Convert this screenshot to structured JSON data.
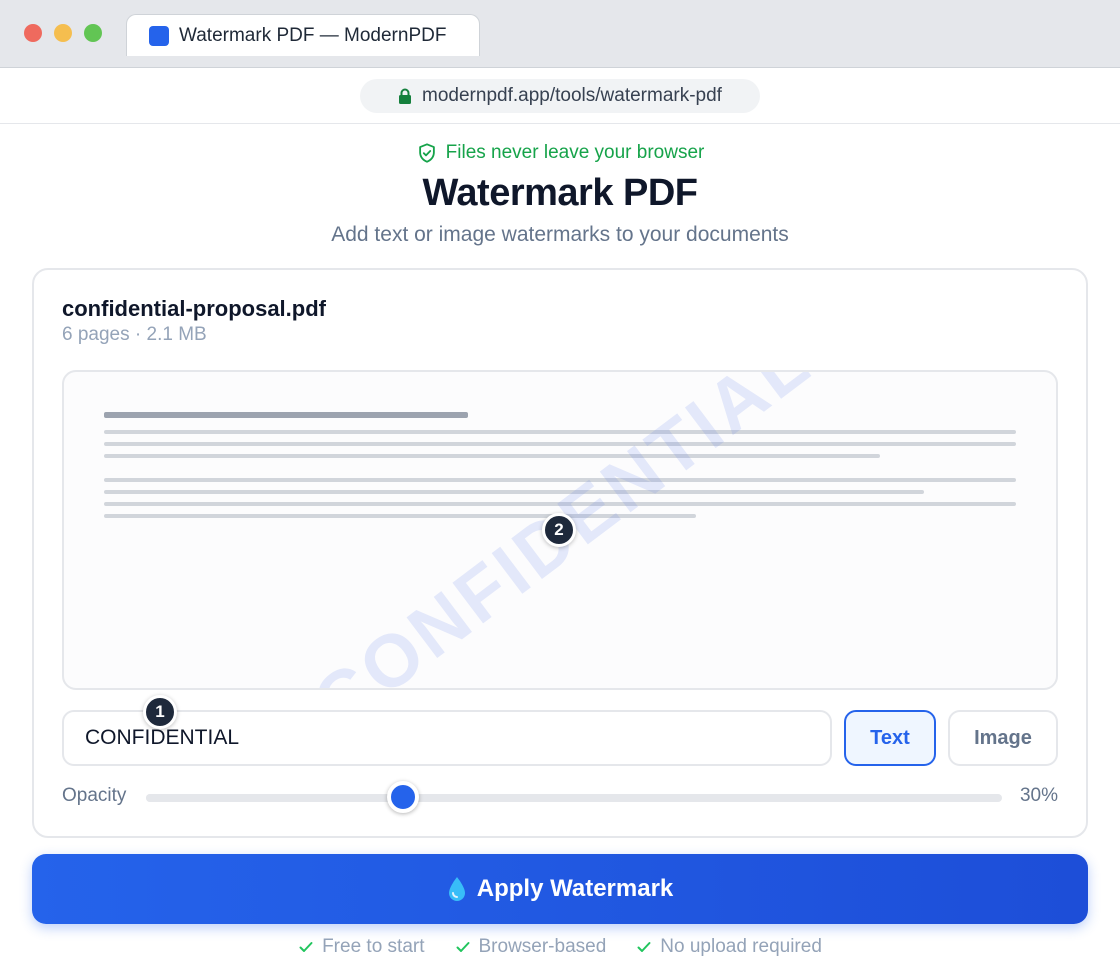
{
  "browser": {
    "tab_title": "Watermark PDF — ModernPDF",
    "url": "modernpdf.app/tools/watermark-pdf"
  },
  "header": {
    "trust_text": "Files never leave your browser",
    "title": "Watermark PDF",
    "subtitle": "Add text or image watermarks to your documents"
  },
  "file": {
    "name": "confidential-proposal.pdf",
    "meta": "6 pages · 2.1 MB"
  },
  "preview": {
    "watermark_text": "CONFIDENTIAL"
  },
  "controls": {
    "watermark_input_value": "CONFIDENTIAL",
    "mode_text_label": "Text",
    "mode_image_label": "Image",
    "active_mode": "Text",
    "opacity_label": "Opacity",
    "opacity_value_text": "30%",
    "opacity": 0.3
  },
  "steps": {
    "step1": "1",
    "step2": "2"
  },
  "cta": {
    "apply_label": "Apply Watermark"
  },
  "features": [
    "Free to start",
    "Browser-based",
    "No upload required"
  ],
  "colors": {
    "accent": "#2563eb",
    "trust_green": "#16a34a",
    "muted": "#94a3b8"
  },
  "icons": {
    "tab": "favicon-icon",
    "url": "lock-icon",
    "trust": "shield-check-icon",
    "cta": "droplet-icon",
    "feature": "check-icon"
  }
}
